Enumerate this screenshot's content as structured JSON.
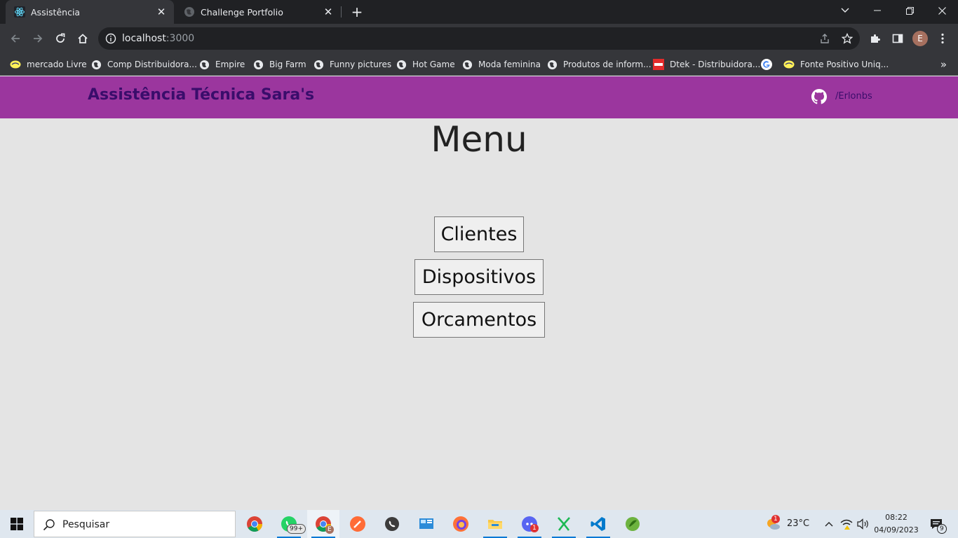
{
  "browser": {
    "tabs": [
      {
        "title": "Assistência",
        "active": true
      },
      {
        "title": "Challenge Portfolio",
        "active": false
      }
    ],
    "window_controls": [
      "chevron-down",
      "minimize",
      "restore",
      "close"
    ],
    "url": {
      "host": "localhost",
      "port": ":3000"
    },
    "profile_initial": "E",
    "bookmarks": [
      {
        "label": "mercado Livre",
        "icon": "handshake-icon"
      },
      {
        "label": "Comp Distribuidora...",
        "icon": "globe-icon"
      },
      {
        "label": "Empire",
        "icon": "globe-icon"
      },
      {
        "label": "Big Farm",
        "icon": "globe-icon"
      },
      {
        "label": "Funny pictures",
        "icon": "globe-icon"
      },
      {
        "label": "Hot Game",
        "icon": "globe-icon"
      },
      {
        "label": "Moda feminina",
        "icon": "globe-icon"
      },
      {
        "label": "Produtos de inform...",
        "icon": "globe-icon"
      },
      {
        "label": "Dtek - Distribuidora...",
        "icon": "dtek-icon"
      },
      {
        "label": "",
        "icon": "google-icon"
      },
      {
        "label": "Fonte Positivo Uniq...",
        "icon": "handshake-icon"
      }
    ],
    "bookmarks_overflow": "»"
  },
  "page": {
    "header": {
      "brand": "Assistência Técnica Sara's",
      "github_label": "/Erlonbs"
    },
    "title": "Menu",
    "menu_buttons": [
      "Clientes",
      "Dispositivos",
      "Orcamentos"
    ]
  },
  "taskbar": {
    "search_placeholder": "Pesquisar",
    "badges": {
      "whatsapp": "99+",
      "chrome_profile": "E",
      "discord": "1",
      "weather": "1",
      "notifications": "9"
    },
    "weather_temp": "23°C",
    "time": "08:22",
    "date": "04/09/2023"
  },
  "colors": {
    "app_header": "#9b369e",
    "brand_text": "#3a0d6b",
    "page_bg": "#e4e4e4"
  }
}
